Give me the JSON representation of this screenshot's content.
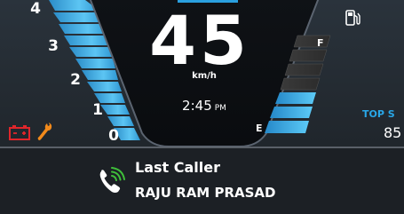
{
  "speedometer": {
    "speed": "45",
    "unit": "km/h"
  },
  "clock": {
    "time": "2:45",
    "ampm": "PM"
  },
  "tachometer": {
    "scale": [
      "0",
      "1",
      "2",
      "3",
      "4"
    ],
    "bar_color": "#3aa6e0"
  },
  "fuel_gauge": {
    "full_label": "F",
    "empty_label": "E",
    "level_fraction": 0.25,
    "fuel_icon": "fuel-pump-icon"
  },
  "top_speed": {
    "label": "TOP S",
    "value": "85",
    "accent": "#29a7e8"
  },
  "warnings": {
    "battery_icon": "battery-icon",
    "wrench_icon": "wrench-icon",
    "battery_color": "#e0262b",
    "wrench_color": "#f28a1b"
  },
  "caller": {
    "label": "Last Caller",
    "name": "RAJU RAM PRASAD",
    "call_icon": "phone-call-icon",
    "call_icon_color": "#3fbf3a"
  }
}
